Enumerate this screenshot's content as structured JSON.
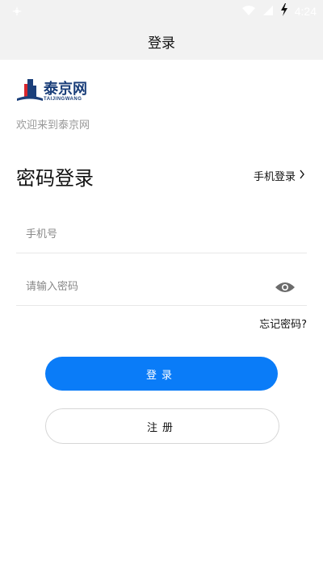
{
  "status_bar": {
    "time": "4:24",
    "icons": [
      "notification-icon",
      "wifi-icon",
      "signal-icon",
      "battery-charging-icon"
    ]
  },
  "nav": {
    "title": "登录"
  },
  "logo": {
    "text": "泰京网",
    "subtext": "TAIJINGWANG"
  },
  "welcome": "欢迎来到泰京网",
  "form": {
    "title": "密码登录",
    "switch_label": "手机登录",
    "phone_placeholder": "手机号",
    "password_placeholder": "请输入密码",
    "forgot_label": "忘记密码?",
    "login_label": "登录",
    "register_label": "注册"
  },
  "colors": {
    "primary": "#0a7cf8",
    "logo_blue": "#1b3f7a",
    "logo_red": "#d8262d",
    "header_bg": "#f2f2f2"
  }
}
